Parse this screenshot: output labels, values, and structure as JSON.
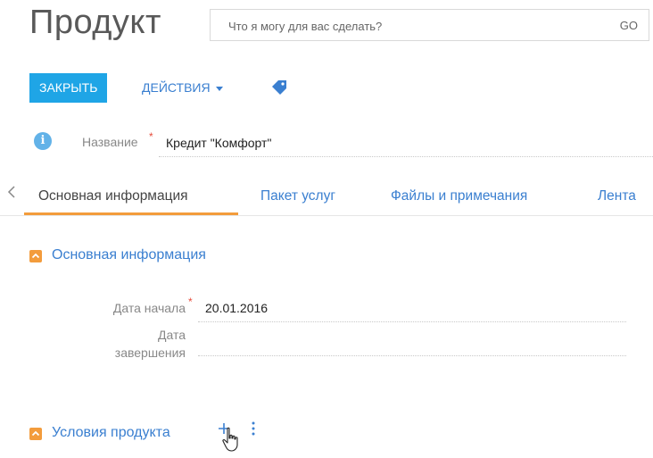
{
  "header": {
    "title": "Продукт",
    "search_placeholder": "Что я могу для вас сделать?",
    "search_go": "GO"
  },
  "actions": {
    "close_label": "ЗАКРЫТЬ",
    "actions_label": "ДЕЙСТВИЯ",
    "tag_icon": "tag-icon"
  },
  "name_field": {
    "label": "Название",
    "required_mark": "*",
    "value": "Кредит \"Комфорт\""
  },
  "tabs": [
    {
      "label": "Основная информация",
      "active": true
    },
    {
      "label": "Пакет услуг",
      "active": false
    },
    {
      "label": "Файлы и примечания",
      "active": false
    },
    {
      "label": "Лента",
      "active": false
    }
  ],
  "section_main": {
    "title": "Основная информация",
    "start_date": {
      "label": "Дата начала",
      "required_mark": "*",
      "value": "20.01.2016"
    },
    "end_date": {
      "label_line1": "Дата",
      "label_line2": "завершения",
      "value": ""
    }
  },
  "section_terms": {
    "title": "Условия продукта"
  },
  "colors": {
    "accent_blue": "#1fa5e6",
    "link_blue": "#3a7fd0",
    "orange": "#f39c3c",
    "required_red": "#e74c3c"
  }
}
